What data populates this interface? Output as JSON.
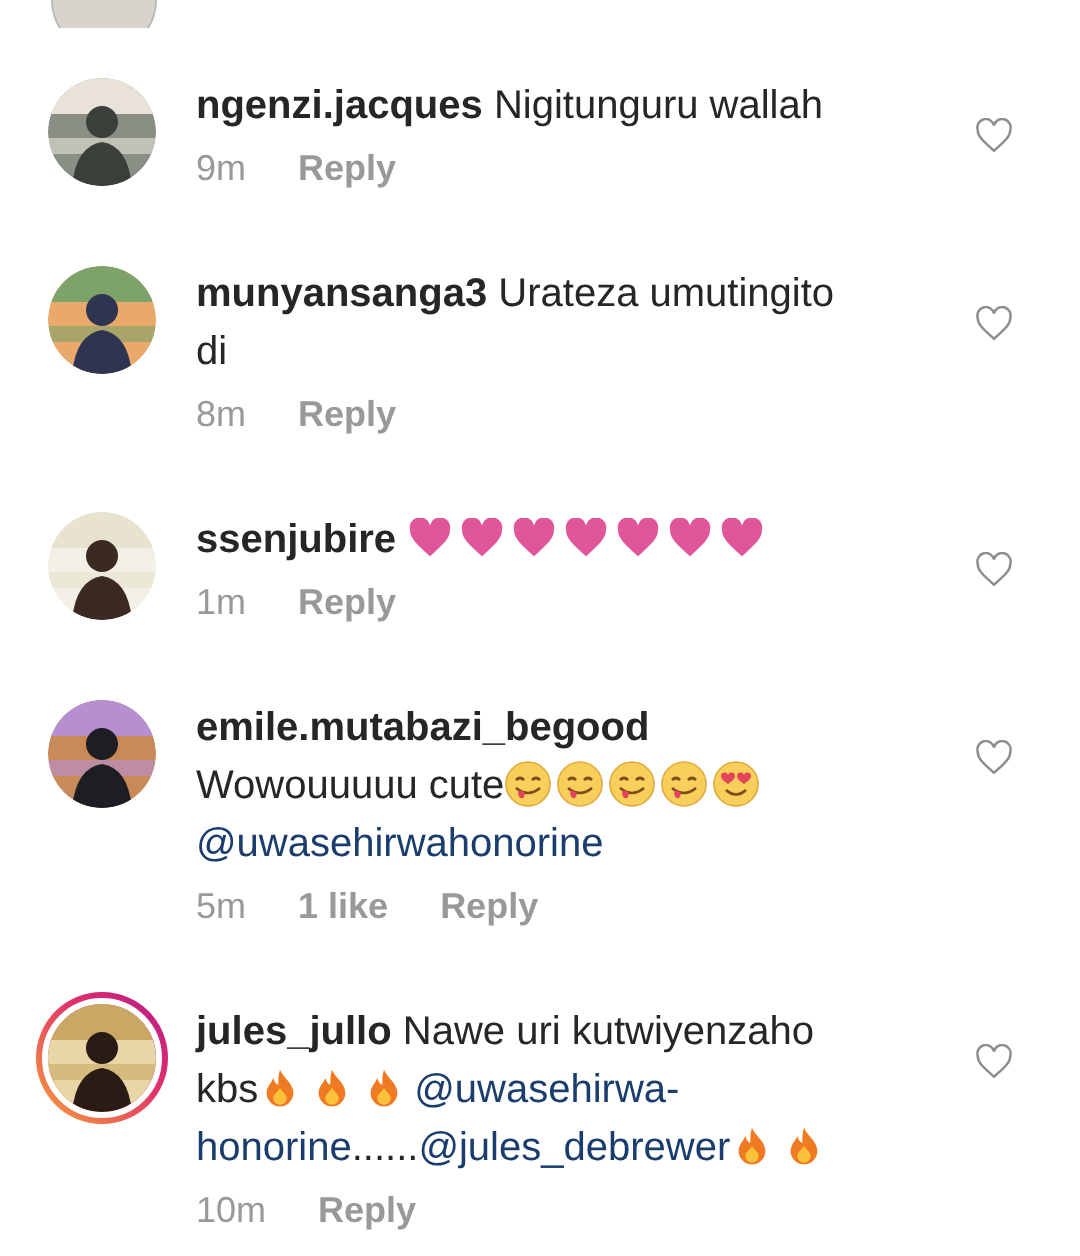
{
  "comments": [
    {
      "user": "ngenzi.jacques",
      "segments": [
        {
          "kind": "text",
          "text": "Nigitunguru wallah"
        }
      ],
      "time": "9m",
      "reply": "Reply",
      "liked": false,
      "story_ring": false
    },
    {
      "user": "munyansanga3",
      "segments": [
        {
          "kind": "text",
          "text": "Urateza umutingito di"
        }
      ],
      "time": "8m",
      "reply": "Reply",
      "liked": false,
      "story_ring": false
    },
    {
      "user": "ssenjubire",
      "segments": [
        {
          "kind": "heart"
        },
        {
          "kind": "heart"
        },
        {
          "kind": "heart"
        },
        {
          "kind": "heart"
        },
        {
          "kind": "heart"
        },
        {
          "kind": "heart"
        },
        {
          "kind": "heart"
        }
      ],
      "time": "1m",
      "reply": "Reply",
      "liked": false,
      "story_ring": false
    },
    {
      "user": "emile.mutabazi_begood",
      "segments": [
        {
          "kind": "text",
          "text": "Wowouuuuu cute"
        },
        {
          "kind": "yum"
        },
        {
          "kind": "yum"
        },
        {
          "kind": "yum"
        },
        {
          "kind": "yum"
        },
        {
          "kind": "hearteyes"
        },
        {
          "kind": "mention",
          "text": "@uwasehirwahonorine"
        }
      ],
      "time": "5m",
      "likes": "1 like",
      "reply": "Reply",
      "liked": false,
      "story_ring": false
    },
    {
      "user": "jules_jullo",
      "segments": [
        {
          "kind": "text",
          "text": "Nawe uri kutwiyenzaho kbs"
        },
        {
          "kind": "fire"
        },
        {
          "kind": "fire"
        },
        {
          "kind": "fire"
        },
        {
          "kind": "mention",
          "text": "@uwasehirwa-honorine"
        },
        {
          "kind": "text",
          "text": "......"
        },
        {
          "kind": "mention",
          "text": "@jules_debrewer"
        },
        {
          "kind": "fire"
        },
        {
          "kind": "fire"
        }
      ],
      "time": "10m",
      "reply": "Reply",
      "liked": false,
      "story_ring": true
    }
  ]
}
